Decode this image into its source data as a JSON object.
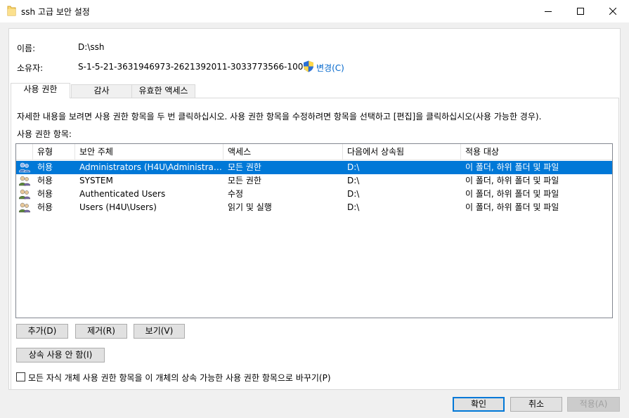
{
  "window": {
    "title": "ssh 고급 보안 설정",
    "minimize_label": "최소화",
    "maximize_label": "최대화",
    "close_label": "닫기"
  },
  "info": {
    "name_label": "이름:",
    "name_value": "D:\\ssh",
    "owner_label": "소유자:",
    "owner_value": "S-1-5-21-3631946973-2621392011-3033773566-1001",
    "change_link": "변경(C)"
  },
  "tabs": [
    {
      "label": "사용 권한",
      "active": true
    },
    {
      "label": "감사",
      "active": false
    },
    {
      "label": "유효한 액세스",
      "active": false
    }
  ],
  "panel": {
    "description": "자세한 내용을 보려면 사용 권한 항목을 두 번 클릭하십시오. 사용 권한 항목을 수정하려면 항목을 선택하고 [편집]을 클릭하십시오(사용 가능한 경우).",
    "entries_label": "사용 권한 항목:"
  },
  "table": {
    "columns": [
      "유형",
      "보안 주체",
      "액세스",
      "다음에서 상속됨",
      "적용 대상"
    ],
    "rows": [
      [
        "허용",
        "Administrators (H4U\\Administrato...",
        "모든 권한",
        "D:\\",
        "이 폴더, 하위 폴더 및 파일"
      ],
      [
        "허용",
        "SYSTEM",
        "모든 권한",
        "D:\\",
        "이 폴더, 하위 폴더 및 파일"
      ],
      [
        "허용",
        "Authenticated Users",
        "수정",
        "D:\\",
        "이 폴더, 하위 폴더 및 파일"
      ],
      [
        "허용",
        "Users (H4U\\Users)",
        "읽기 및 실행",
        "D:\\",
        "이 폴더, 하위 폴더 및 파일"
      ]
    ],
    "selected_row": 0
  },
  "buttons": {
    "add": "추가(D)",
    "remove": "제거(R)",
    "view": "보기(V)",
    "disable_inheritance": "상속 사용 안 함(I)",
    "ok": "확인",
    "cancel": "취소",
    "apply": "적용(A)"
  },
  "checkbox": {
    "label": "모든 자식 개체 사용 권한 항목을 이 개체의 상속 가능한 사용 권한 항목으로 바꾸기(P)",
    "checked": false
  },
  "colors": {
    "selection": "#0078d7",
    "link": "#0066cc",
    "folder": "#f8d775"
  }
}
